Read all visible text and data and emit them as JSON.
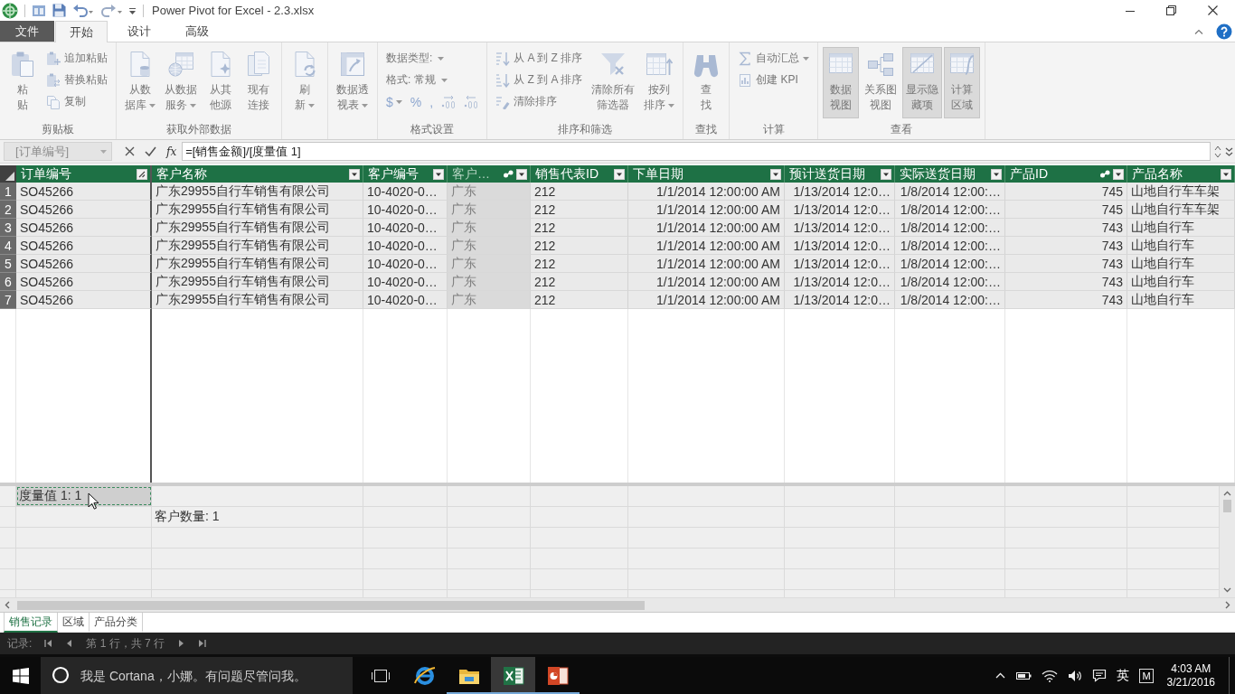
{
  "title_bar": {
    "title": "Power Pivot for Excel - 2.3.xlsx"
  },
  "ribbon_tabs": [
    {
      "label": "文件",
      "kind": "file",
      "selected": false
    },
    {
      "label": "开始",
      "kind": "tab",
      "selected": true
    },
    {
      "label": "设计",
      "kind": "tab",
      "selected": false
    },
    {
      "label": "高级",
      "kind": "tab",
      "selected": false
    }
  ],
  "ribbon": {
    "groups": [
      {
        "label": "剪贴板",
        "items": [
          {
            "kind": "large",
            "lines": [
              "粘",
              "贴"
            ]
          },
          {
            "kind": "stack",
            "rows": [
              {
                "kind": "button",
                "label": "追加粘贴"
              },
              {
                "kind": "button",
                "label": "替换粘贴"
              },
              {
                "kind": "button",
                "label": "复制"
              }
            ]
          }
        ]
      },
      {
        "label": "获取外部数据",
        "items": [
          {
            "kind": "large",
            "lines": [
              "从数",
              "据库"
            ],
            "dropdown": true
          },
          {
            "kind": "large",
            "lines": [
              "从数据",
              "服务"
            ],
            "dropdown": true
          },
          {
            "kind": "large",
            "lines": [
              "从其",
              "他源"
            ]
          },
          {
            "kind": "large",
            "lines": [
              "现有",
              "连接"
            ]
          }
        ]
      },
      {
        "items": [
          {
            "kind": "large",
            "lines": [
              "刷",
              "新"
            ],
            "dropdown": true
          }
        ]
      },
      {
        "items": [
          {
            "kind": "large",
            "lines": [
              "数据透",
              "视表"
            ],
            "dropdown": true
          }
        ]
      },
      {
        "label": "格式设置",
        "items": [
          {
            "kind": "stack",
            "rows": [
              {
                "kind": "menu",
                "label": "数据类型:",
                "dropdown": true
              },
              {
                "kind": "menu",
                "label": "格式: 常规",
                "dropdown": true
              },
              {
                "kind": "symbols",
                "symbols": [
                  {
                    "kind": "text",
                    "label": "$",
                    "dropdown": true
                  },
                  {
                    "kind": "text",
                    "label": "%"
                  },
                  {
                    "kind": "text",
                    "label": ","
                  },
                  {
                    "kind": "icon"
                  },
                  {
                    "kind": "icon"
                  }
                ]
              }
            ]
          }
        ]
      },
      {
        "label": "排序和筛选",
        "items": [
          {
            "kind": "stack",
            "rows": [
              {
                "kind": "button",
                "label": "从 A 到 Z 排序"
              },
              {
                "kind": "button",
                "label": "从 Z 到 A 排序"
              },
              {
                "kind": "button",
                "label": "清除排序"
              }
            ]
          },
          {
            "kind": "large",
            "lines": [
              "清除所有",
              "筛选器"
            ]
          },
          {
            "kind": "large",
            "lines": [
              "按列",
              "排序"
            ],
            "dropdown": true
          }
        ]
      },
      {
        "label": "查找",
        "items": [
          {
            "kind": "large",
            "lines": [
              "查",
              "找"
            ]
          }
        ]
      },
      {
        "label": "计算",
        "items": [
          {
            "kind": "stack",
            "rows": [
              {
                "kind": "button",
                "label": "自动汇总",
                "dropdown": true
              },
              {
                "kind": "button",
                "label": "创建 KPI"
              }
            ]
          }
        ]
      },
      {
        "label": "查看",
        "items": [
          {
            "kind": "large",
            "lines": [
              "数据",
              "视图"
            ],
            "selected": true
          },
          {
            "kind": "large",
            "lines": [
              "关系图",
              "视图"
            ],
            "selected": false
          },
          {
            "kind": "large",
            "lines": [
              "显示隐",
              "藏项"
            ],
            "selected": true
          },
          {
            "kind": "large",
            "lines": [
              "计算",
              "区域"
            ],
            "selected": true
          }
        ]
      }
    ]
  },
  "formula_bar": {
    "name_box": "[订单编号]",
    "function_label": "fx",
    "formula": "=[销售金额]/[度量值 1]"
  },
  "table": {
    "columns": [
      {
        "label": "订单编号",
        "kind": "text",
        "selected": true,
        "relationship": false,
        "grayed": false
      },
      {
        "label": "客户名称",
        "kind": "text",
        "selected": false,
        "relationship": false,
        "grayed": false
      },
      {
        "label": "客户编号",
        "kind": "text",
        "selected": false,
        "relationship": false,
        "grayed": false
      },
      {
        "label": "客户…",
        "kind": "text",
        "selected": false,
        "relationship": true,
        "grayed": true
      },
      {
        "label": "销售代表ID",
        "kind": "text",
        "selected": false,
        "relationship": false,
        "grayed": false
      },
      {
        "label": "下单日期",
        "kind": "date",
        "selected": false,
        "relationship": false,
        "grayed": false
      },
      {
        "label": "预计送货日期",
        "kind": "date",
        "selected": false,
        "relationship": false,
        "grayed": false
      },
      {
        "label": "实际送货日期",
        "kind": "date",
        "selected": false,
        "relationship": false,
        "grayed": false
      },
      {
        "label": "产品ID",
        "kind": "number",
        "selected": false,
        "relationship": true,
        "grayed": false
      },
      {
        "label": "产品名称",
        "kind": "text",
        "selected": false,
        "relationship": false,
        "grayed": false
      }
    ],
    "rows": [
      {
        "number": "1",
        "cells": [
          "SO45266",
          "广东29955自行车销售有限公司",
          "10-4020-0…",
          "广东",
          "212",
          "1/1/2014 12:00:00 AM",
          "1/13/2014 12:0…",
          "1/8/2014 12:00:…",
          "745",
          "山地自行车车架"
        ]
      },
      {
        "number": "2",
        "cells": [
          "SO45266",
          "广东29955自行车销售有限公司",
          "10-4020-0…",
          "广东",
          "212",
          "1/1/2014 12:00:00 AM",
          "1/13/2014 12:0…",
          "1/8/2014 12:00:…",
          "745",
          "山地自行车车架"
        ]
      },
      {
        "number": "3",
        "cells": [
          "SO45266",
          "广东29955自行车销售有限公司",
          "10-4020-0…",
          "广东",
          "212",
          "1/1/2014 12:00:00 AM",
          "1/13/2014 12:0…",
          "1/8/2014 12:00:…",
          "743",
          "山地自行车"
        ]
      },
      {
        "number": "4",
        "cells": [
          "SO45266",
          "广东29955自行车销售有限公司",
          "10-4020-0…",
          "广东",
          "212",
          "1/1/2014 12:00:00 AM",
          "1/13/2014 12:0…",
          "1/8/2014 12:00:…",
          "743",
          "山地自行车"
        ]
      },
      {
        "number": "5",
        "cells": [
          "SO45266",
          "广东29955自行车销售有限公司",
          "10-4020-0…",
          "广东",
          "212",
          "1/1/2014 12:00:00 AM",
          "1/13/2014 12:0…",
          "1/8/2014 12:00:…",
          "743",
          "山地自行车"
        ]
      },
      {
        "number": "6",
        "cells": [
          "SO45266",
          "广东29955自行车销售有限公司",
          "10-4020-0…",
          "广东",
          "212",
          "1/1/2014 12:00:00 AM",
          "1/13/2014 12:0…",
          "1/8/2014 12:00:…",
          "743",
          "山地自行车"
        ]
      },
      {
        "number": "7",
        "cells": [
          "SO45266",
          "广东29955自行车销售有限公司",
          "10-4020-0…",
          "广东",
          "212",
          "1/1/2014 12:00:00 AM",
          "1/13/2014 12:0…",
          "1/8/2014 12:00:…",
          "743",
          "山地自行车"
        ]
      }
    ]
  },
  "calculation_area": {
    "rows": [
      {
        "cells": [
          {
            "kind": "measure",
            "text": "度量值 1: 1",
            "selected": true
          }
        ]
      },
      {
        "cells": [
          {
            "kind": "blank"
          },
          {
            "kind": "measure",
            "text": "客户数量: 1",
            "selected": false
          }
        ]
      }
    ]
  },
  "sheet_tabs": [
    {
      "label": "销售记录",
      "selected": true
    },
    {
      "label": "区域",
      "selected": false
    },
    {
      "label": "产品分类",
      "selected": false
    }
  ],
  "record_bar": {
    "label": "记录:",
    "position": "第 1 行，共 7 行"
  },
  "taskbar": {
    "search": {
      "placeholder": "我是 Cortana，小娜。有问题尽管问我。"
    },
    "apps": [
      {
        "kind": "task_view",
        "running": false,
        "selected": false
      },
      {
        "kind": "browser",
        "running": false,
        "selected": false
      },
      {
        "kind": "file_explorer",
        "running": true,
        "selected": false
      },
      {
        "kind": "excel",
        "running": true,
        "selected": true
      },
      {
        "kind": "powerpoint",
        "running": true,
        "selected": false
      }
    ],
    "tray": {
      "input_language": "英",
      "ime_mode": "M",
      "time": "4:03 AM",
      "date": "3/21/2016"
    }
  }
}
